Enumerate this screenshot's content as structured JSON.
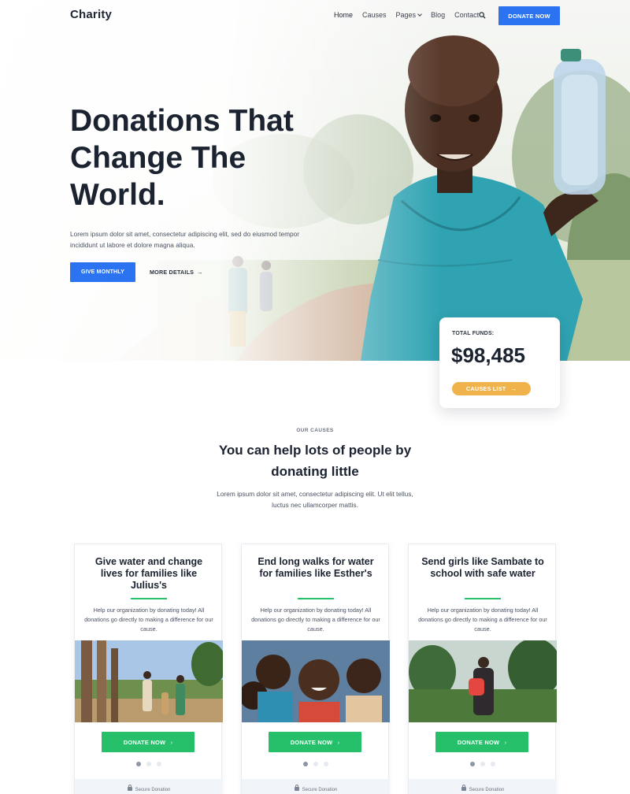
{
  "header": {
    "logo": "Charity",
    "nav": [
      "Home",
      "Causes",
      "Pages",
      "Blog",
      "Contact"
    ],
    "donate_label": "DONATE NOW"
  },
  "hero": {
    "title": "Donations That Change The World.",
    "text": "Lorem ipsum dolor sit amet, consectetur adipiscing elit, sed do eiusmod tempor incididunt ut labore et dolore magna aliqua.",
    "primary_button": "GIVE MONTHLY",
    "secondary_link": "MORE DETAILS",
    "arrow": "→"
  },
  "funds": {
    "label": "TOTAL FUNDS:",
    "amount": "$98,485",
    "button": "CAUSES LIST",
    "arrow": "→"
  },
  "causes": {
    "eyebrow": "OUR CAUSES",
    "title": "You can help lots of people by donating little",
    "text": "Lorem ipsum dolor sit amet, consectetur adipiscing elit. Ut elit tellus, luctus nec ullamcorper mattis.",
    "cards": [
      {
        "title": "Give water and change lives for families like Julius's",
        "text": "Help our organization by donating today! All donations go directly to making a difference for our cause.",
        "button": "DONATE NOW",
        "chevron": "›",
        "footer": "Secure Donation"
      },
      {
        "title": "End long walks for water for families like Esther's",
        "text": "Help our organization by donating today! All donations go directly to making a difference for our cause.",
        "button": "DONATE NOW",
        "chevron": "›",
        "footer": "Secure Donation"
      },
      {
        "title": "Send girls like Sambate to school with safe water",
        "text": "Help our organization by donating today! All donations go directly to making a difference for our cause.",
        "button": "DONATE NOW",
        "chevron": "›",
        "footer": "Secure Donation"
      }
    ]
  },
  "colors": {
    "primary": "#2b73f0",
    "accent_green": "#26c06b",
    "accent_orange": "#f0b24a",
    "heading": "#1b2230"
  }
}
